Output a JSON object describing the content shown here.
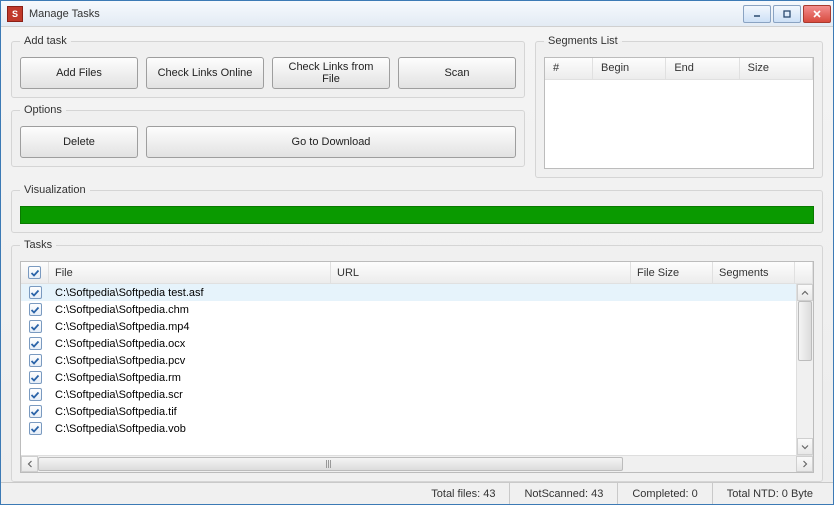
{
  "window": {
    "title": "Manage Tasks",
    "icon_text": "S"
  },
  "groups": {
    "add_task": "Add task",
    "options": "Options",
    "segments": "Segments List",
    "visualization": "Visualization",
    "tasks": "Tasks"
  },
  "buttons": {
    "add_files": "Add Files",
    "check_links_online": "Check Links Online",
    "check_links_file": "Check Links from File",
    "scan": "Scan",
    "delete": "Delete",
    "go_download": "Go to Download"
  },
  "segments_headers": {
    "num": "#",
    "begin": "Begin",
    "end": "End",
    "size": "Size"
  },
  "tasks_headers": {
    "file": "File",
    "url": "URL",
    "file_size": "File Size",
    "segments": "Segments"
  },
  "tasks_rows": [
    {
      "file": "C:\\Softpedia\\Softpedia test.asf",
      "selected": true
    },
    {
      "file": "C:\\Softpedia\\Softpedia.chm"
    },
    {
      "file": "C:\\Softpedia\\Softpedia.mp4"
    },
    {
      "file": "C:\\Softpedia\\Softpedia.ocx"
    },
    {
      "file": "C:\\Softpedia\\Softpedia.pcv"
    },
    {
      "file": "C:\\Softpedia\\Softpedia.rm"
    },
    {
      "file": "C:\\Softpedia\\Softpedia.scr"
    },
    {
      "file": "C:\\Softpedia\\Softpedia.tif"
    },
    {
      "file": "C:\\Softpedia\\Softpedia.vob"
    }
  ],
  "status": {
    "total_files": "Total files: 43",
    "not_scanned": "NotScanned: 43",
    "completed": "Completed: 0",
    "total_ntd": "Total NTD: 0 Byte"
  }
}
